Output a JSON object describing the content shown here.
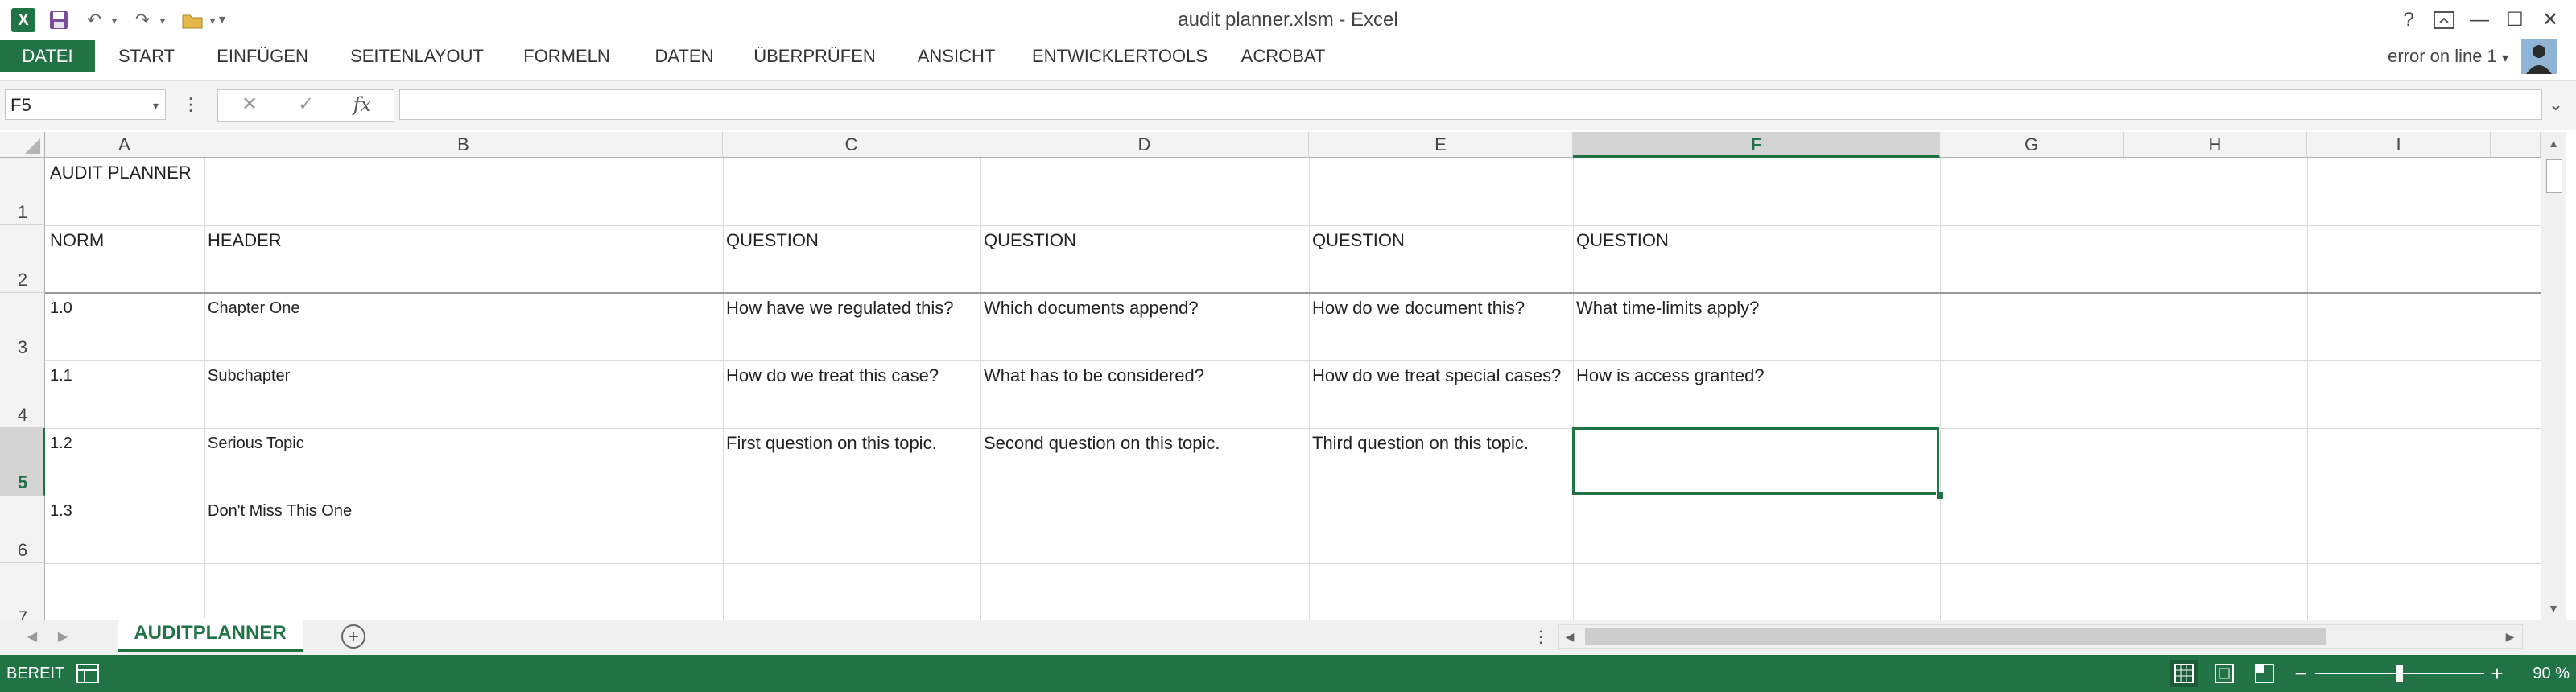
{
  "window": {
    "title": "audit planner.xlsm - Excel",
    "help_icon": "?",
    "restore_ribbon_icon": "⇱",
    "minimize_icon": "—",
    "maximize_icon": "☐",
    "close_icon": "✕"
  },
  "quick_access": {
    "app_icon": "X",
    "save_icon": "💾",
    "undo_icon": "↶",
    "redo_icon": "↷",
    "customize_icon": "▾"
  },
  "ribbon": {
    "tabs": [
      "DATEI",
      "START",
      "EINFÜGEN",
      "SEITENLAYOUT",
      "FORMELN",
      "DATEN",
      "ÜBERPRÜFEN",
      "ANSICHT",
      "ENTWICKLERTOOLS",
      "ACROBAT"
    ],
    "active_tab": "DATEI",
    "user_label": "error on line 1",
    "user_dropdown_icon": "▾",
    "active_color": "#217346"
  },
  "formula_bar": {
    "name_box": "F5",
    "name_box_dropdown": "▾",
    "more_icon": "⋮",
    "cancel_icon": "✕",
    "enter_icon": "✓",
    "fx_icon": "fx",
    "formula": "",
    "expand_icon": "⌄"
  },
  "columns": [
    "A",
    "B",
    "C",
    "D",
    "E",
    "F",
    "G",
    "H",
    "I"
  ],
  "selected_column": "F",
  "rows": [
    "1",
    "2",
    "3",
    "4",
    "5",
    "6",
    "7"
  ],
  "selected_row": "5",
  "cells": {
    "A1": "AUDIT PLANNER",
    "A2": "NORM",
    "B2": "HEADER",
    "C2": "QUESTION",
    "D2": "QUESTION",
    "E2": "QUESTION",
    "F2": "QUESTION",
    "A3": "1.0",
    "B3": "Chapter One",
    "C3": "How have we regulated this?",
    "D3": "Which documents append?",
    "E3": "How do we document this?",
    "F3": "What time-limits apply?",
    "A4": "1.1",
    "B4": "Subchapter",
    "C4": "How do we treat this case?",
    "D4": "What has to be considered?",
    "E4": "How do we treat special cases?",
    "F4": "How is access granted?",
    "A5": "1.2",
    "B5": "Serious Topic",
    "C5": "First question on this topic.",
    "D5": "Second question on this topic.",
    "E5": "Third question on this topic.",
    "F5": "",
    "A6": "1.3",
    "B6": "Don't Miss This One"
  },
  "sheet_tabs": {
    "prev_icon": "◀",
    "next_icon": "▶",
    "active_sheet": "AUDITPLANNER",
    "add_icon": "+",
    "more_icon": "⋮"
  },
  "status_bar": {
    "mode": "BEREIT",
    "macro_icon": "▦",
    "normal_view_icon": "▦",
    "page_layout_icon": "▤",
    "page_break_icon": "▥",
    "zoom_out": "−",
    "zoom_in": "+",
    "zoom": "90 %",
    "zoom_fraction": 0.5
  }
}
